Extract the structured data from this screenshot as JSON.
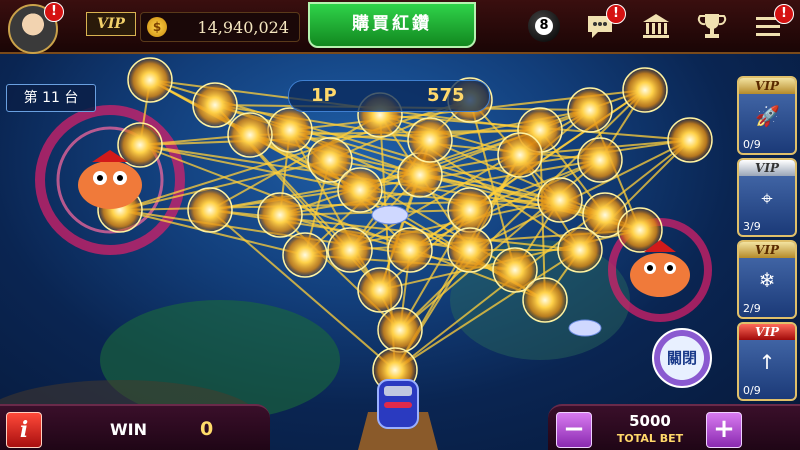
{
  "topbar": {
    "vip_label": "VIP",
    "coin_symbol": "$",
    "coin_balance": "14,940,024",
    "buy_button_label": "購買紅鑽",
    "alert_mark": "!",
    "ball_number": "8",
    "icons": [
      "avatar-icon",
      "coin-icon",
      "eight-ball-icon",
      "chat-icon",
      "bank-icon",
      "trophy-icon",
      "menu-icon"
    ]
  },
  "table": {
    "label": "第 11 台"
  },
  "score": {
    "prefix": "1P",
    "value": "575"
  },
  "vip_panel": [
    {
      "title": "VIP",
      "icon": "missile-icon",
      "count": "0/9"
    },
    {
      "title": "VIP",
      "icon": "target-icon",
      "count": "3/9"
    },
    {
      "title": "VIP",
      "icon": "ice-crystal-icon",
      "count": "2/9"
    },
    {
      "title": "VIP",
      "icon": "rocket-icon",
      "count": "0/9"
    }
  ],
  "close_button_label": "關閉",
  "bottom": {
    "info_label": "i",
    "win_label": "WIN",
    "win_value": "0",
    "minus_label": "−",
    "plus_label": "+",
    "bet_value": "5000",
    "bet_label": "TOTAL BET"
  },
  "colors": {
    "lightning": "#ffcf3a",
    "buy_green": "#1fb63a",
    "bet_purple": "#b04ad8"
  }
}
